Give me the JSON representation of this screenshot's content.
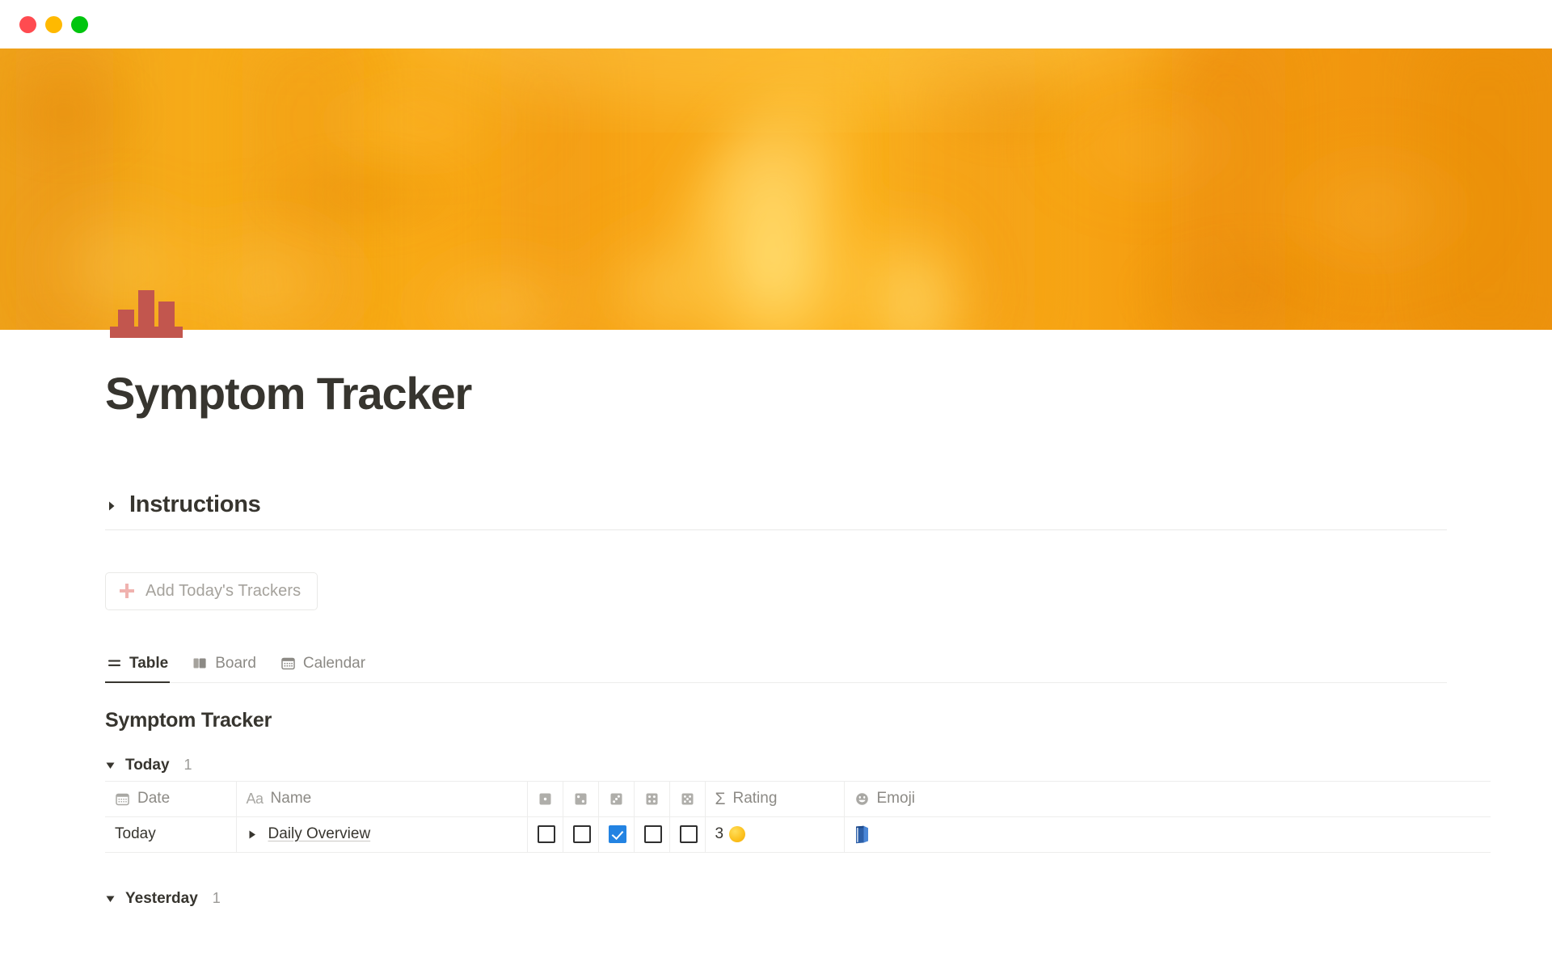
{
  "window": {
    "traffic_lights": [
      {
        "name": "close",
        "color": "#FF4B50"
      },
      {
        "name": "minimize",
        "color": "#FFB900"
      },
      {
        "name": "maximize",
        "color": "#00C50E"
      }
    ]
  },
  "cover": {
    "description": "abstract orange smoke",
    "base_color": "#F6A117",
    "highlight_color": "#FFD24A"
  },
  "page": {
    "icon": "bar-chart-icon",
    "icon_color": "#C2564E",
    "title": "Symptom Tracker"
  },
  "instructions_toggle": {
    "label": "Instructions",
    "expanded": false,
    "arrow": "triangle-right"
  },
  "add_button": {
    "label": "Add Today's Trackers",
    "icon": "plus-icon",
    "icon_color": "#F0B2AF"
  },
  "views": {
    "tabs": [
      {
        "label": "Table",
        "icon": "table-icon",
        "active": true
      },
      {
        "label": "Board",
        "icon": "board-icon",
        "active": false
      },
      {
        "label": "Calendar",
        "icon": "calendar-icon",
        "active": false
      }
    ]
  },
  "database": {
    "title": "Symptom Tracker",
    "columns": [
      {
        "label": "Date",
        "icon": "calendar-icon",
        "type": "date"
      },
      {
        "label": "Name",
        "icon": "aa-icon",
        "type": "title"
      },
      {
        "label": "1",
        "icon": "dice-1-icon",
        "type": "checkbox"
      },
      {
        "label": "2",
        "icon": "dice-2-icon",
        "type": "checkbox"
      },
      {
        "label": "3",
        "icon": "dice-3-icon",
        "type": "checkbox"
      },
      {
        "label": "4",
        "icon": "dice-4-icon",
        "type": "checkbox"
      },
      {
        "label": "5",
        "icon": "dice-5-icon",
        "type": "checkbox"
      },
      {
        "label": "Rating",
        "icon": "sigma-icon",
        "type": "formula"
      },
      {
        "label": "Emoji",
        "icon": "smiley-icon",
        "type": "text"
      }
    ],
    "groups": [
      {
        "name": "Today",
        "count": "1",
        "collapsed": false,
        "caret": "triangle-down",
        "rows": [
          {
            "date": "Today",
            "name": "Daily Overview",
            "checkboxes": [
              false,
              false,
              true,
              false,
              false
            ],
            "rating_value": "3",
            "rating_dot_color": "#FCC11E",
            "emoji": "blue-book"
          }
        ]
      },
      {
        "name": "Yesterday",
        "count": "1",
        "collapsed": false,
        "caret": "triangle-down",
        "rows": []
      }
    ]
  },
  "colors": {
    "accent_checkbox": "#2383E2",
    "text_primary": "#37352F",
    "text_muted": "#9B9A97",
    "border": "#EDEDEC"
  }
}
